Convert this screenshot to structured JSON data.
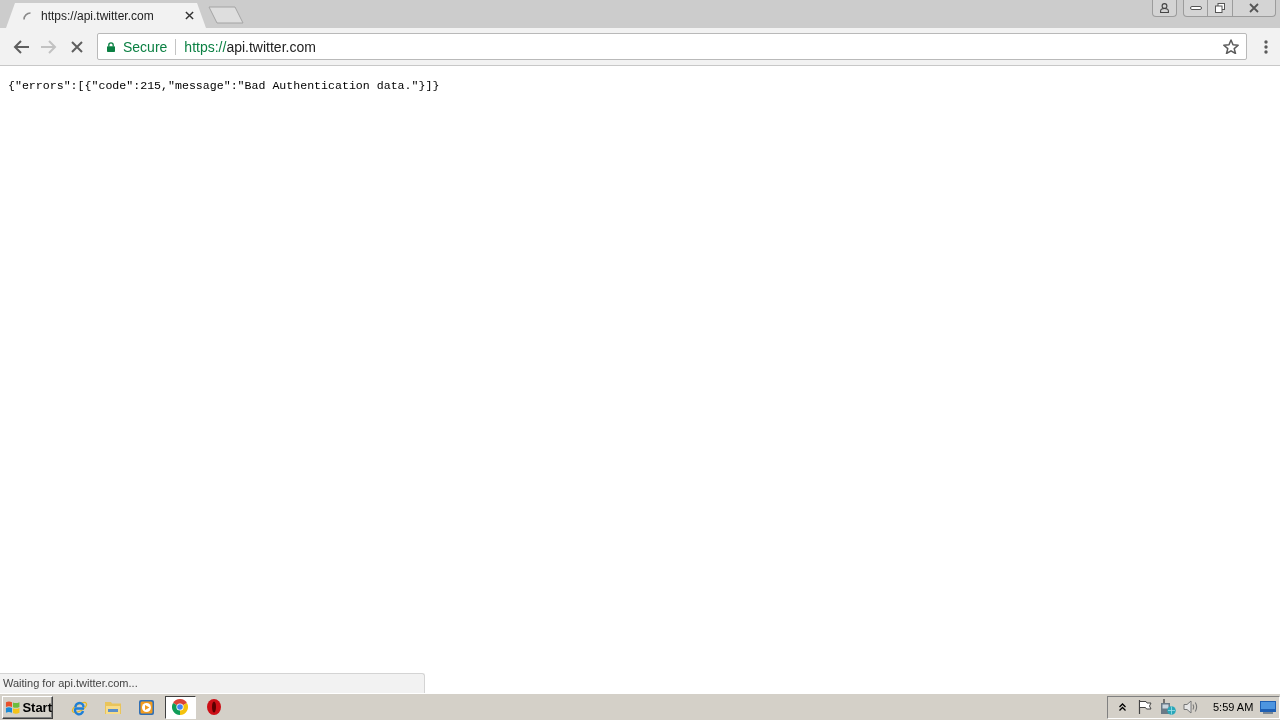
{
  "window": {
    "tabs": [
      {
        "title": "https://api.twitter.com",
        "selected": true,
        "loading": true
      }
    ]
  },
  "toolbar": {
    "nav_buttons": [
      {
        "kind": "back",
        "disabled": false
      },
      {
        "kind": "forward",
        "disabled": true
      },
      {
        "kind": "stop",
        "disabled": false
      }
    ],
    "omnibox": {
      "security_label": "Secure",
      "url_scheme": "https://",
      "url_host": "api.twitter.com",
      "bookmarked": false
    }
  },
  "page": {
    "body_text": "{\"errors\":[{\"code\":215,\"message\":\"Bad Authentication data.\"}]}"
  },
  "status_bubble": {
    "text": "Waiting for api.twitter.com..."
  },
  "taskbar": {
    "start_label": "Start",
    "apps": [
      {
        "kind": "ie",
        "selected": false
      },
      {
        "kind": "folder",
        "selected": false
      },
      {
        "kind": "media",
        "selected": false
      },
      {
        "kind": "chrome",
        "selected": true
      },
      {
        "kind": "opera",
        "selected": false
      }
    ],
    "tray": {
      "icons": [
        {
          "kind": "chevron"
        },
        {
          "kind": "flag"
        },
        {
          "kind": "network"
        },
        {
          "kind": "volume"
        }
      ],
      "clock": "5:59 AM"
    }
  }
}
